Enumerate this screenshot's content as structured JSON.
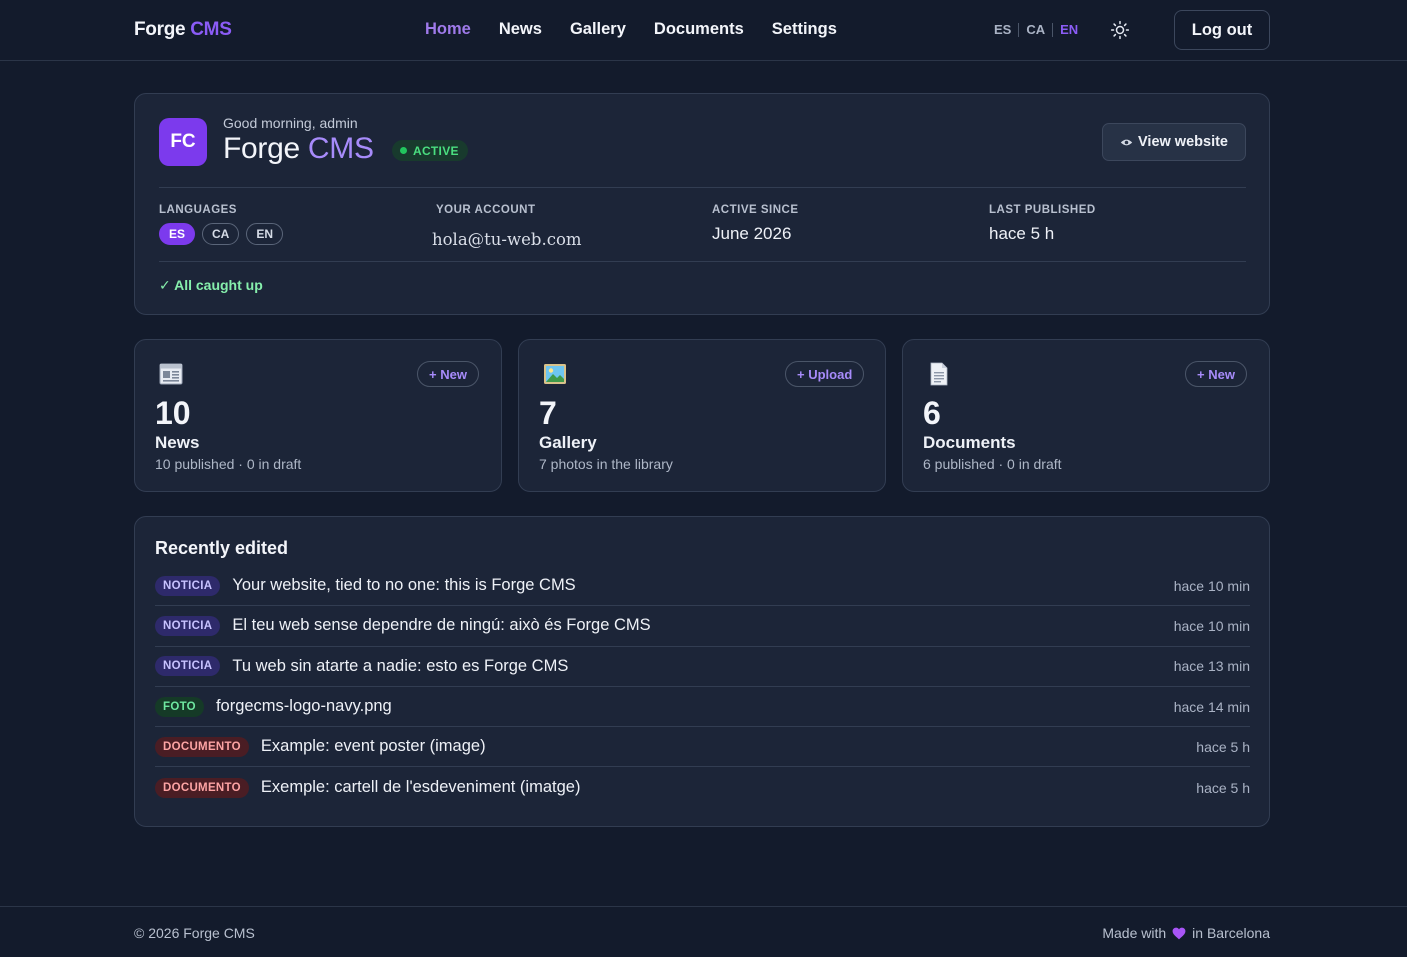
{
  "brand": {
    "name": "Forge",
    "accent": "CMS"
  },
  "nav": {
    "links": [
      {
        "label": "Home",
        "active": true
      },
      {
        "label": "News"
      },
      {
        "label": "Gallery"
      },
      {
        "label": "Documents"
      },
      {
        "label": "Settings"
      }
    ],
    "languages": [
      "ES",
      "CA",
      "EN"
    ],
    "current_language": "EN",
    "theme_icon": "sun-icon",
    "logout_label": "Log out"
  },
  "hero": {
    "avatar": "FC",
    "greeting": "Good morning, admin",
    "site_name": "Forge",
    "site_name_accent": "CMS",
    "status": "ACTIVE",
    "view_website_icon": "eye-icon",
    "view_website_label": "View website",
    "languages_label": "LANGUAGES",
    "languages": [
      "ES",
      "CA",
      "EN"
    ],
    "active_language": "ES",
    "account_label": "YOUR ACCOUNT",
    "account_value": "hola@tu-web.com",
    "active_since_label": "ACTIVE SINCE",
    "active_since_value": "June 2026",
    "last_published_label": "LAST PUBLISHED",
    "last_published_value": "hace 5 h",
    "caught_up": "✓ All caught up"
  },
  "stats": [
    {
      "icon": "newspaper-icon",
      "button": "+ New",
      "count": "10",
      "title": "News",
      "sub": "10 published · 0 in draft"
    },
    {
      "icon": "picture-icon",
      "button": "+ Upload",
      "count": "7",
      "title": "Gallery",
      "sub": "7 photos in the library"
    },
    {
      "icon": "document-icon",
      "button": "+ New",
      "count": "6",
      "title": "Documents",
      "sub": "6 published · 0 in draft"
    }
  ],
  "recent": {
    "title": "Recently edited",
    "items": [
      {
        "tag": "NOTICIA",
        "type": "noticia",
        "title": "Your website, tied to no one: this is Forge CMS",
        "time": "hace 10 min"
      },
      {
        "tag": "NOTICIA",
        "type": "noticia",
        "title": "El teu web sense dependre de ningú: això és Forge CMS",
        "time": "hace 10 min"
      },
      {
        "tag": "NOTICIA",
        "type": "noticia",
        "title": "Tu web sin atarte a nadie: esto es Forge CMS",
        "time": "hace 13 min"
      },
      {
        "tag": "FOTO",
        "type": "foto",
        "title": "forgecms-logo-navy.png",
        "time": "hace 14 min"
      },
      {
        "tag": "DOCUMENTO",
        "type": "documento",
        "title": "Example: event poster (image)",
        "time": "hace 5 h"
      },
      {
        "tag": "DOCUMENTO",
        "type": "documento",
        "title": "Exemple: cartell de l'esdeveniment (imatge)",
        "time": "hace 5 h"
      }
    ]
  },
  "footer": {
    "copyright": "© 2026 Forge CMS",
    "made_with": "Made with",
    "heart_icon": "heart-icon",
    "location": "in Barcelona"
  },
  "colors": {
    "accent": "#8b5cf6",
    "background": "#131b2c",
    "card": "#1c2538",
    "success": "#22c55e"
  }
}
